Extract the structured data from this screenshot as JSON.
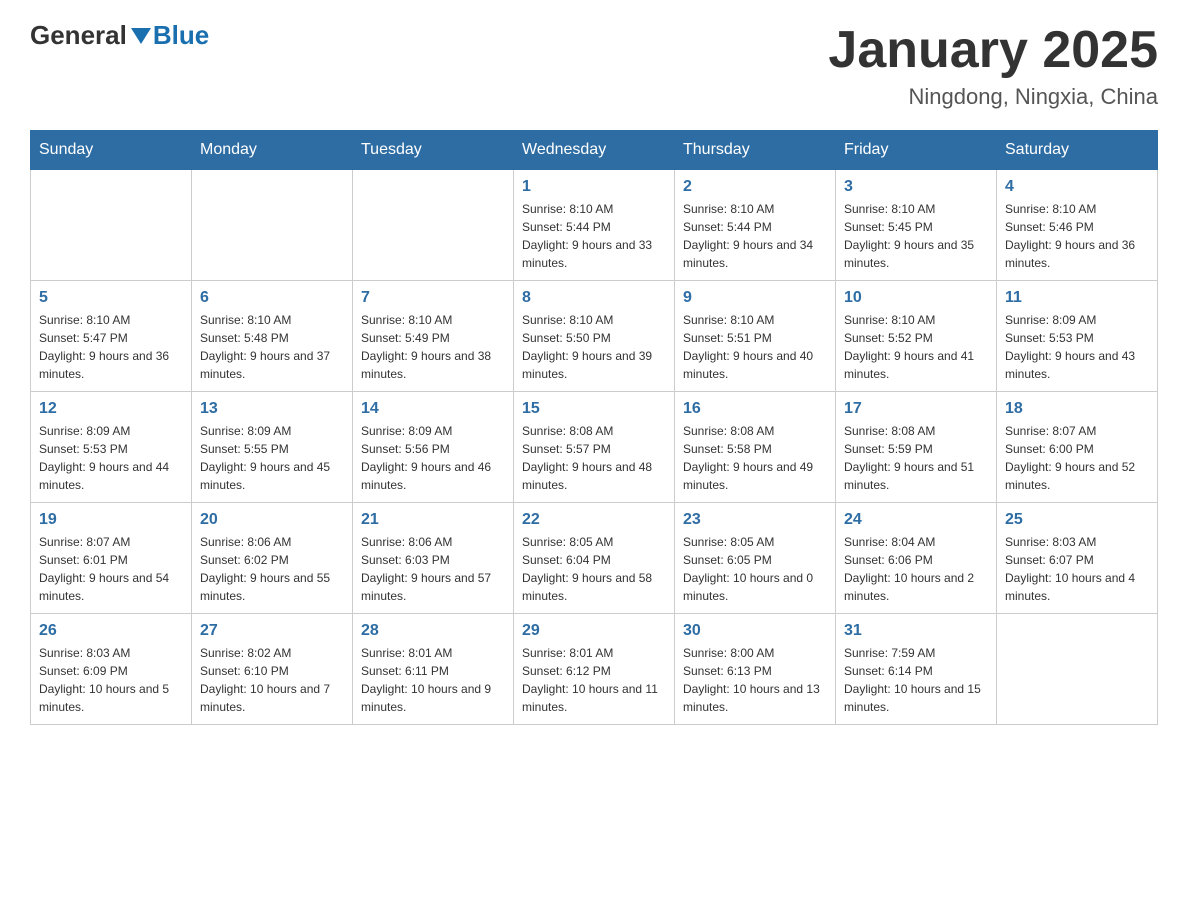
{
  "header": {
    "logo_general": "General",
    "logo_blue": "Blue",
    "title": "January 2025",
    "subtitle": "Ningdong, Ningxia, China"
  },
  "days_of_week": [
    "Sunday",
    "Monday",
    "Tuesday",
    "Wednesday",
    "Thursday",
    "Friday",
    "Saturday"
  ],
  "weeks": [
    [
      {
        "day": "",
        "info": ""
      },
      {
        "day": "",
        "info": ""
      },
      {
        "day": "",
        "info": ""
      },
      {
        "day": "1",
        "info": "Sunrise: 8:10 AM\nSunset: 5:44 PM\nDaylight: 9 hours and 33 minutes."
      },
      {
        "day": "2",
        "info": "Sunrise: 8:10 AM\nSunset: 5:44 PM\nDaylight: 9 hours and 34 minutes."
      },
      {
        "day": "3",
        "info": "Sunrise: 8:10 AM\nSunset: 5:45 PM\nDaylight: 9 hours and 35 minutes."
      },
      {
        "day": "4",
        "info": "Sunrise: 8:10 AM\nSunset: 5:46 PM\nDaylight: 9 hours and 36 minutes."
      }
    ],
    [
      {
        "day": "5",
        "info": "Sunrise: 8:10 AM\nSunset: 5:47 PM\nDaylight: 9 hours and 36 minutes."
      },
      {
        "day": "6",
        "info": "Sunrise: 8:10 AM\nSunset: 5:48 PM\nDaylight: 9 hours and 37 minutes."
      },
      {
        "day": "7",
        "info": "Sunrise: 8:10 AM\nSunset: 5:49 PM\nDaylight: 9 hours and 38 minutes."
      },
      {
        "day": "8",
        "info": "Sunrise: 8:10 AM\nSunset: 5:50 PM\nDaylight: 9 hours and 39 minutes."
      },
      {
        "day": "9",
        "info": "Sunrise: 8:10 AM\nSunset: 5:51 PM\nDaylight: 9 hours and 40 minutes."
      },
      {
        "day": "10",
        "info": "Sunrise: 8:10 AM\nSunset: 5:52 PM\nDaylight: 9 hours and 41 minutes."
      },
      {
        "day": "11",
        "info": "Sunrise: 8:09 AM\nSunset: 5:53 PM\nDaylight: 9 hours and 43 minutes."
      }
    ],
    [
      {
        "day": "12",
        "info": "Sunrise: 8:09 AM\nSunset: 5:53 PM\nDaylight: 9 hours and 44 minutes."
      },
      {
        "day": "13",
        "info": "Sunrise: 8:09 AM\nSunset: 5:55 PM\nDaylight: 9 hours and 45 minutes."
      },
      {
        "day": "14",
        "info": "Sunrise: 8:09 AM\nSunset: 5:56 PM\nDaylight: 9 hours and 46 minutes."
      },
      {
        "day": "15",
        "info": "Sunrise: 8:08 AM\nSunset: 5:57 PM\nDaylight: 9 hours and 48 minutes."
      },
      {
        "day": "16",
        "info": "Sunrise: 8:08 AM\nSunset: 5:58 PM\nDaylight: 9 hours and 49 minutes."
      },
      {
        "day": "17",
        "info": "Sunrise: 8:08 AM\nSunset: 5:59 PM\nDaylight: 9 hours and 51 minutes."
      },
      {
        "day": "18",
        "info": "Sunrise: 8:07 AM\nSunset: 6:00 PM\nDaylight: 9 hours and 52 minutes."
      }
    ],
    [
      {
        "day": "19",
        "info": "Sunrise: 8:07 AM\nSunset: 6:01 PM\nDaylight: 9 hours and 54 minutes."
      },
      {
        "day": "20",
        "info": "Sunrise: 8:06 AM\nSunset: 6:02 PM\nDaylight: 9 hours and 55 minutes."
      },
      {
        "day": "21",
        "info": "Sunrise: 8:06 AM\nSunset: 6:03 PM\nDaylight: 9 hours and 57 minutes."
      },
      {
        "day": "22",
        "info": "Sunrise: 8:05 AM\nSunset: 6:04 PM\nDaylight: 9 hours and 58 minutes."
      },
      {
        "day": "23",
        "info": "Sunrise: 8:05 AM\nSunset: 6:05 PM\nDaylight: 10 hours and 0 minutes."
      },
      {
        "day": "24",
        "info": "Sunrise: 8:04 AM\nSunset: 6:06 PM\nDaylight: 10 hours and 2 minutes."
      },
      {
        "day": "25",
        "info": "Sunrise: 8:03 AM\nSunset: 6:07 PM\nDaylight: 10 hours and 4 minutes."
      }
    ],
    [
      {
        "day": "26",
        "info": "Sunrise: 8:03 AM\nSunset: 6:09 PM\nDaylight: 10 hours and 5 minutes."
      },
      {
        "day": "27",
        "info": "Sunrise: 8:02 AM\nSunset: 6:10 PM\nDaylight: 10 hours and 7 minutes."
      },
      {
        "day": "28",
        "info": "Sunrise: 8:01 AM\nSunset: 6:11 PM\nDaylight: 10 hours and 9 minutes."
      },
      {
        "day": "29",
        "info": "Sunrise: 8:01 AM\nSunset: 6:12 PM\nDaylight: 10 hours and 11 minutes."
      },
      {
        "day": "30",
        "info": "Sunrise: 8:00 AM\nSunset: 6:13 PM\nDaylight: 10 hours and 13 minutes."
      },
      {
        "day": "31",
        "info": "Sunrise: 7:59 AM\nSunset: 6:14 PM\nDaylight: 10 hours and 15 minutes."
      },
      {
        "day": "",
        "info": ""
      }
    ]
  ]
}
